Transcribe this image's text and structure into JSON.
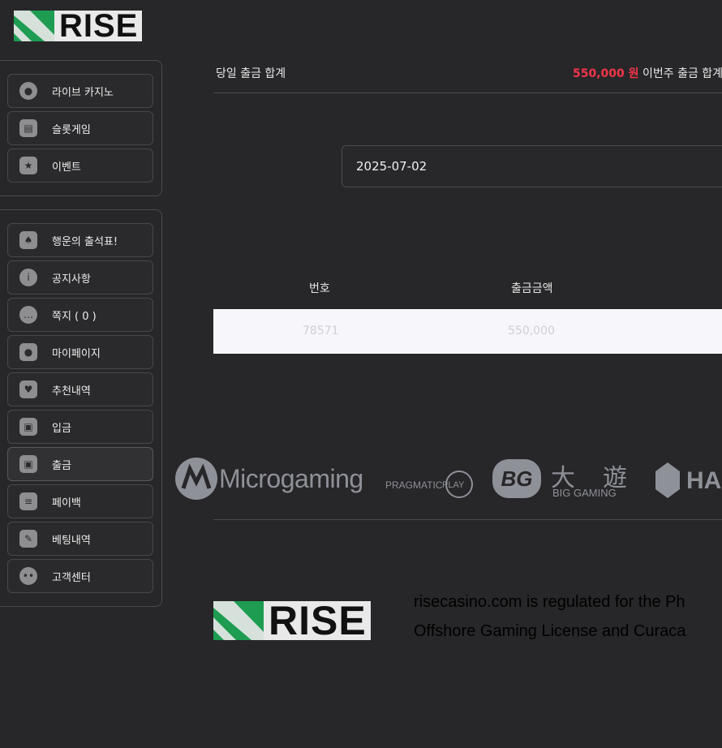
{
  "brand": {
    "name": "RISE"
  },
  "sidebar": {
    "group1": [
      {
        "label": "라이브 카지노",
        "icon": "chips-icon"
      },
      {
        "label": "슬롯게임",
        "icon": "slot-machine-icon"
      },
      {
        "label": "이벤트",
        "icon": "star-badge-icon"
      }
    ],
    "group2": [
      {
        "label": "행운의 출석표!",
        "icon": "calendar-icon"
      },
      {
        "label": "공지사항",
        "icon": "info-icon"
      },
      {
        "label": "쪽지 ( 0 )",
        "icon": "message-icon"
      },
      {
        "label": "마이페이지",
        "icon": "user-icon"
      },
      {
        "label": "추천내역",
        "icon": "heart-icon"
      },
      {
        "label": "입금",
        "icon": "wallet-in-icon"
      },
      {
        "label": "출금",
        "icon": "wallet-out-icon"
      },
      {
        "label": "페이백",
        "icon": "coins-icon"
      },
      {
        "label": "베팅내역",
        "icon": "edit-note-icon"
      },
      {
        "label": "고객센터",
        "icon": "support-icon"
      }
    ]
  },
  "summary": {
    "daily_label": "당일 출금 합계",
    "daily_amount": "550,000 원",
    "weekly_label": "이번주 출금 합계"
  },
  "filter": {
    "date": "2025-07-02"
  },
  "table": {
    "headers": [
      "번호",
      "출금금액"
    ],
    "rows": [
      {
        "no": "78571",
        "amount": "550,000"
      }
    ]
  },
  "providers": {
    "microgaming": "Microgaming",
    "pragmatic": "PRAGMATIC",
    "pragmatic_play": "PLAY",
    "bg_badge": "BG",
    "bg_chars": "大遊",
    "bg_sub": "BIG GAMING",
    "ha": "HA"
  },
  "footer": {
    "line1": "risecasino.com is regulated for the Ph",
    "line2": "Offshore Gaming License and Curaca"
  },
  "colors": {
    "background": "#272628",
    "accent_red": "#f2354a",
    "brand_green": "#1e9c52"
  }
}
